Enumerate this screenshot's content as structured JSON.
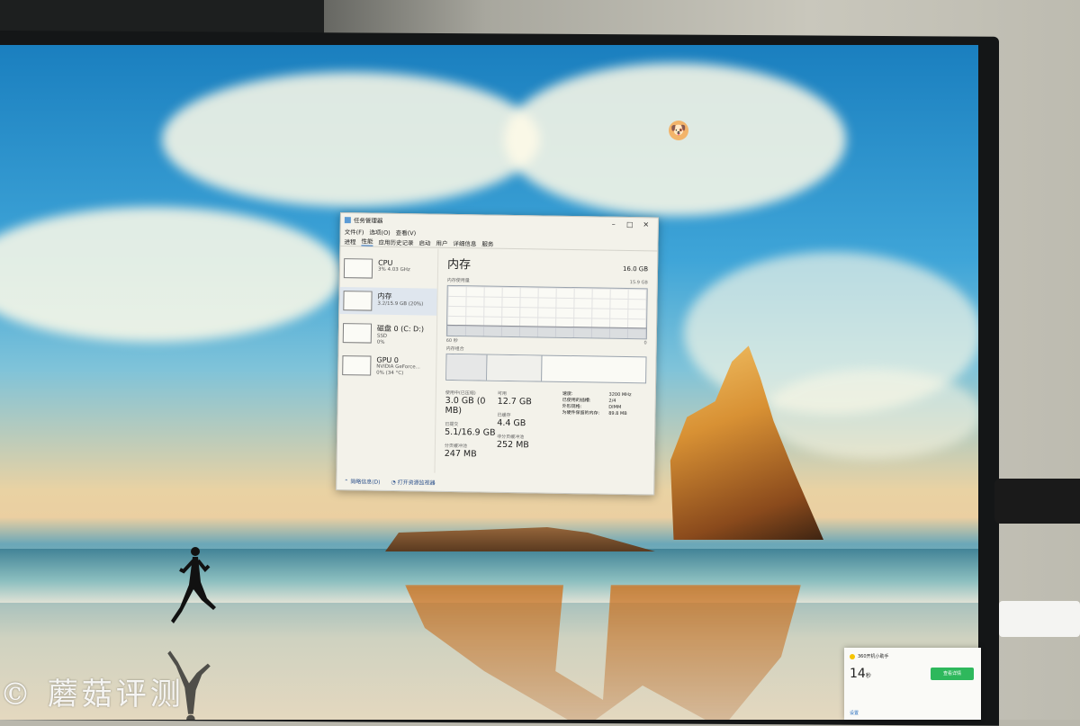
{
  "watermark": "© 蘑菇评测",
  "task_manager": {
    "title": "任务管理器",
    "menu": [
      "文件(F)",
      "选项(O)",
      "查看(V)"
    ],
    "tabs": [
      "进程",
      "性能",
      "应用历史记录",
      "启动",
      "用户",
      "详细信息",
      "服务"
    ],
    "active_tab": 1,
    "resources": [
      {
        "name": "CPU",
        "sub1": "3% 4.03 GHz",
        "sub2": ""
      },
      {
        "name": "内存",
        "sub1": "3.2/15.9 GB (20%)",
        "sub2": ""
      },
      {
        "name": "磁盘 0 (C: D:)",
        "sub1": "SSD",
        "sub2": "0%"
      },
      {
        "name": "GPU 0",
        "sub1": "NVIDIA GeForce...",
        "sub2": "0% (34 °C)"
      }
    ],
    "active_resource": 1,
    "panel": {
      "title": "内存",
      "total": "16.0 GB",
      "usage_caption": "内存使用量",
      "usage_max": "15.9 GB",
      "axis_left": "60 秒",
      "axis_right": "0",
      "usage_fraction": 0.2,
      "composition_caption": "内存组合",
      "stats": [
        [
          {
            "label": "使用中(已压缩)",
            "value": "3.0 GB (0 MB)"
          },
          {
            "label": "已提交",
            "value": "5.1/16.9 GB"
          },
          {
            "label": "分页缓冲池",
            "value": "247 MB"
          }
        ],
        [
          {
            "label": "可用",
            "value": "12.7 GB"
          },
          {
            "label": "已缓存",
            "value": "4.4 GB"
          },
          {
            "label": "非分页缓冲池",
            "value": "252 MB"
          }
        ]
      ],
      "spec_labels": [
        "速度:",
        "已使用的插槽:",
        "外形规格:",
        "为硬件保留的内存:"
      ],
      "spec_values": [
        "3200 MHz",
        "2/4",
        "DIMM",
        "89.8 MB"
      ]
    },
    "footer": {
      "fewer_details": "简略信息(D)",
      "open_monitor": "打开资源监视器"
    }
  },
  "toast": {
    "header": "360开机小助手",
    "number": "14",
    "number_unit": "秒",
    "button": "查看详情",
    "link": "设置"
  },
  "colors": {
    "accent": "#2a6fc0",
    "toast_button": "#2eb85c"
  }
}
